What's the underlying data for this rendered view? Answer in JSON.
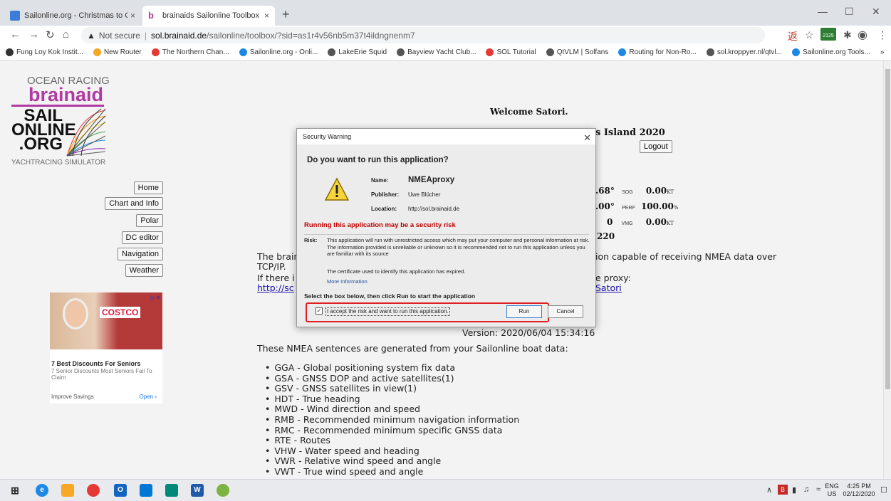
{
  "browser": {
    "tabs": [
      {
        "title": "Sailonline.org - Christmas to Chr",
        "close": "×"
      },
      {
        "title": "brainaids Sailonline Toolbox",
        "close": "×"
      }
    ],
    "new_tab": "+",
    "window_controls": {
      "minimize": "—",
      "maximize": "☐",
      "close": "✕"
    },
    "nav": {
      "back": "←",
      "forward": "→",
      "reload": "↻",
      "home": "⌂"
    },
    "address": {
      "security": "Not secure",
      "separator": "|",
      "host": "sol.brainaid.de",
      "path": "/sailonline/toolbox/?sid=as1r4v56nb5m37t4ildngnenm7"
    },
    "toolbar_icons": [
      "translate-icon",
      "star-icon",
      "extension-icon",
      "puzzle-icon",
      "profile-icon",
      "menu-icon"
    ],
    "extension_badge": "2125",
    "bookmarks": [
      {
        "label": "Fung Loy Kok Instit...",
        "color": "#333"
      },
      {
        "label": "New Router",
        "color": "#f5a623"
      },
      {
        "label": "The Northern Chan...",
        "color": "#e53935"
      },
      {
        "label": "Sailonline.org - Onli...",
        "color": "#1e88e5"
      },
      {
        "label": "LakeErie Squid",
        "color": "#555"
      },
      {
        "label": "Bayview Yacht Club...",
        "color": "#555"
      },
      {
        "label": "SOL Tutorial",
        "color": "#e53935"
      },
      {
        "label": "QtVLM | Solfans",
        "color": "#555"
      },
      {
        "label": "Routing for Non-Ro...",
        "color": "#1e88e5"
      },
      {
        "label": "sol.kroppyer.nl/qtvl...",
        "color": "#555"
      },
      {
        "label": "Sailonline.org Tools...",
        "color": "#1e88e5"
      }
    ],
    "bookmarks_more": "»"
  },
  "logo": {
    "ocean": "OCEAN RACING",
    "brainaid": "brainaid",
    "sail": "SAIL",
    "online": "ONLINE",
    "org": ".ORG",
    "yacht": "YACHTRACING SIMULATOR"
  },
  "sidebar": {
    "buttons": [
      "Home",
      "Chart and Info",
      "Polar",
      "DC editor",
      "Navigation",
      "Weather"
    ]
  },
  "ad": {
    "brand": "COSTCO",
    "adchoices": "▷✕",
    "headline": "7 Best Discounts For Seniors",
    "sub": "7 Senior Discounts Most Seniors Fail To Claim",
    "advertiser": "Improve Savings",
    "cta": "Open ›"
  },
  "main": {
    "welcome": "Welcome Satori.",
    "race_fragment": "s Island 2020",
    "logout": "Logout",
    "stats": [
      {
        "left": ".68°",
        "label": "SOG",
        "value": "0.00",
        "unit": "KT"
      },
      {
        "left": ".00°",
        "label": "PERF",
        "value": "100.00",
        "unit": "%"
      },
      {
        "left": "0",
        "label": "VMG",
        "value": "0.00",
        "unit": "KT"
      },
      {
        "left": "220",
        "label": "",
        "value": "",
        "unit": ""
      }
    ],
    "para_line1_left": "The brair",
    "para_line1_right": "ion capable of receiving NMEA data over",
    "para_line2": "TCP/IP.",
    "para_line3_left": "If there i",
    "para_line3_right": "e proxy:",
    "link_left": "http://sc",
    "link_right": "Satori",
    "version": "Version: 2020/06/04 15:34:16",
    "nmea_intro": "These NMEA sentences are generated from your Sailonline boat data:",
    "nmea": [
      "GGA - Global positioning system fix data",
      "GSA - GNSS DOP and active satellites(1)",
      "GSV - GNSS satellites in view(1)",
      "HDT - True heading",
      "MWD - Wind direction and speed",
      "RMB - Recommended minimum navigation information",
      "RMC - Recommended minimum specific GNSS data",
      "RTE - Routes",
      "VHW - Water speed and heading",
      "VWR - Relative wind speed and angle",
      "VWT - True wind speed and angle"
    ]
  },
  "dialog": {
    "title": "Security Warning",
    "close": "✕",
    "question": "Do you want to run this application?",
    "name_label": "Name:",
    "name_value": "NMEAproxy",
    "publisher_label": "Publisher:",
    "publisher_value": "Uwe Blücher",
    "location_label": "Location:",
    "location_value": "http://sol.brainaid.de",
    "risk_heading": "Running this application may be a security risk",
    "risk_label": "Risk:",
    "risk_text": "This application will run with unrestricted access which may put your computer and personal information at risk. The information provided is unreliable or unknown so it is recommended not to run this application unless you are familiar with its source",
    "cert_text": "The certificate used to identify this application has expired.",
    "more_info": "More Information",
    "select_text": "Select the box below, then click Run to start the application",
    "checkbox_label": "I accept the risk and want to run this application.",
    "checkbox_checked": true,
    "checkmark": "✓",
    "run": "Run",
    "cancel": "Cancel"
  },
  "taskbar": {
    "tray_up": "∧",
    "lang": "ENG",
    "region": "US",
    "time": "4:25 PM",
    "date": "02/12/2020",
    "notification": "☐"
  }
}
